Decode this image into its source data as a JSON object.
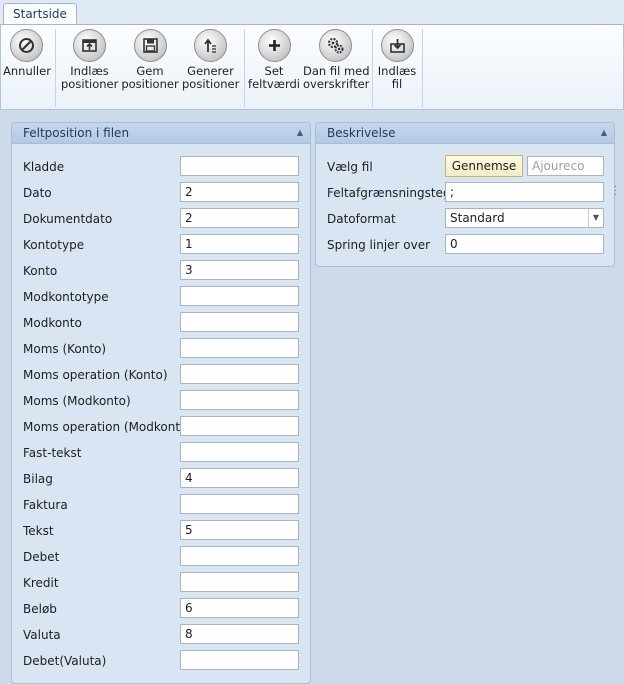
{
  "ribbon": {
    "tab": "Startside",
    "buttons": [
      {
        "name": "annuller-button",
        "icon": "cancel-icon",
        "line1": "Annuller",
        "line2": ""
      },
      {
        "name": "indlaes-positioner-button",
        "icon": "open-folder-icon",
        "line1": "Indlæs",
        "line2": "positioner"
      },
      {
        "name": "gem-positioner-button",
        "icon": "save-disk-icon",
        "line1": "Gem",
        "line2": "positioner"
      },
      {
        "name": "generer-positioner-button",
        "icon": "generate-icon",
        "line1": "Generer",
        "line2": "positioner"
      },
      {
        "name": "set-feltvaerdi-button",
        "icon": "plus-icon",
        "line1": "Set",
        "line2": "feltværdi"
      },
      {
        "name": "dan-fil-button",
        "icon": "gears-icon",
        "line1": "Dan fil med",
        "line2": "overskrifter"
      },
      {
        "name": "indlaes-fil-button",
        "icon": "import-file-icon",
        "line1": "Indlæs",
        "line2": "fil"
      }
    ]
  },
  "left_panel": {
    "title": "Feltposition i filen",
    "fields": [
      {
        "label": "Kladde",
        "value": ""
      },
      {
        "label": "Dato",
        "value": "2"
      },
      {
        "label": "Dokumentdato",
        "value": "2"
      },
      {
        "label": "Kontotype",
        "value": "1"
      },
      {
        "label": "Konto",
        "value": "3"
      },
      {
        "label": "Modkontotype",
        "value": ""
      },
      {
        "label": "Modkonto",
        "value": ""
      },
      {
        "label": "Moms (Konto)",
        "value": ""
      },
      {
        "label": "Moms operation (Konto)",
        "value": ""
      },
      {
        "label": "Moms (Modkonto)",
        "value": ""
      },
      {
        "label": "Moms operation (Modkonto)",
        "value": ""
      },
      {
        "label": "Fast-tekst",
        "value": ""
      },
      {
        "label": "Bilag",
        "value": "4"
      },
      {
        "label": "Faktura",
        "value": ""
      },
      {
        "label": "Tekst",
        "value": "5"
      },
      {
        "label": "Debet",
        "value": ""
      },
      {
        "label": "Kredit",
        "value": ""
      },
      {
        "label": "Beløb",
        "value": "6"
      },
      {
        "label": "Valuta",
        "value": "8"
      },
      {
        "label": "Debet(Valuta)",
        "value": ""
      }
    ]
  },
  "right_panel": {
    "title": "Beskrivelse",
    "file_label": "Vælg fil",
    "browse_label": "Gennemse",
    "file_placeholder": "Ajoureco",
    "delimiter_label": "Feltafgrænsningstegn",
    "delimiter_value": ";",
    "dateformat_label": "Datoformat",
    "dateformat_value": "Standard",
    "skip_label": "Spring linjer over",
    "skip_value": "0"
  }
}
